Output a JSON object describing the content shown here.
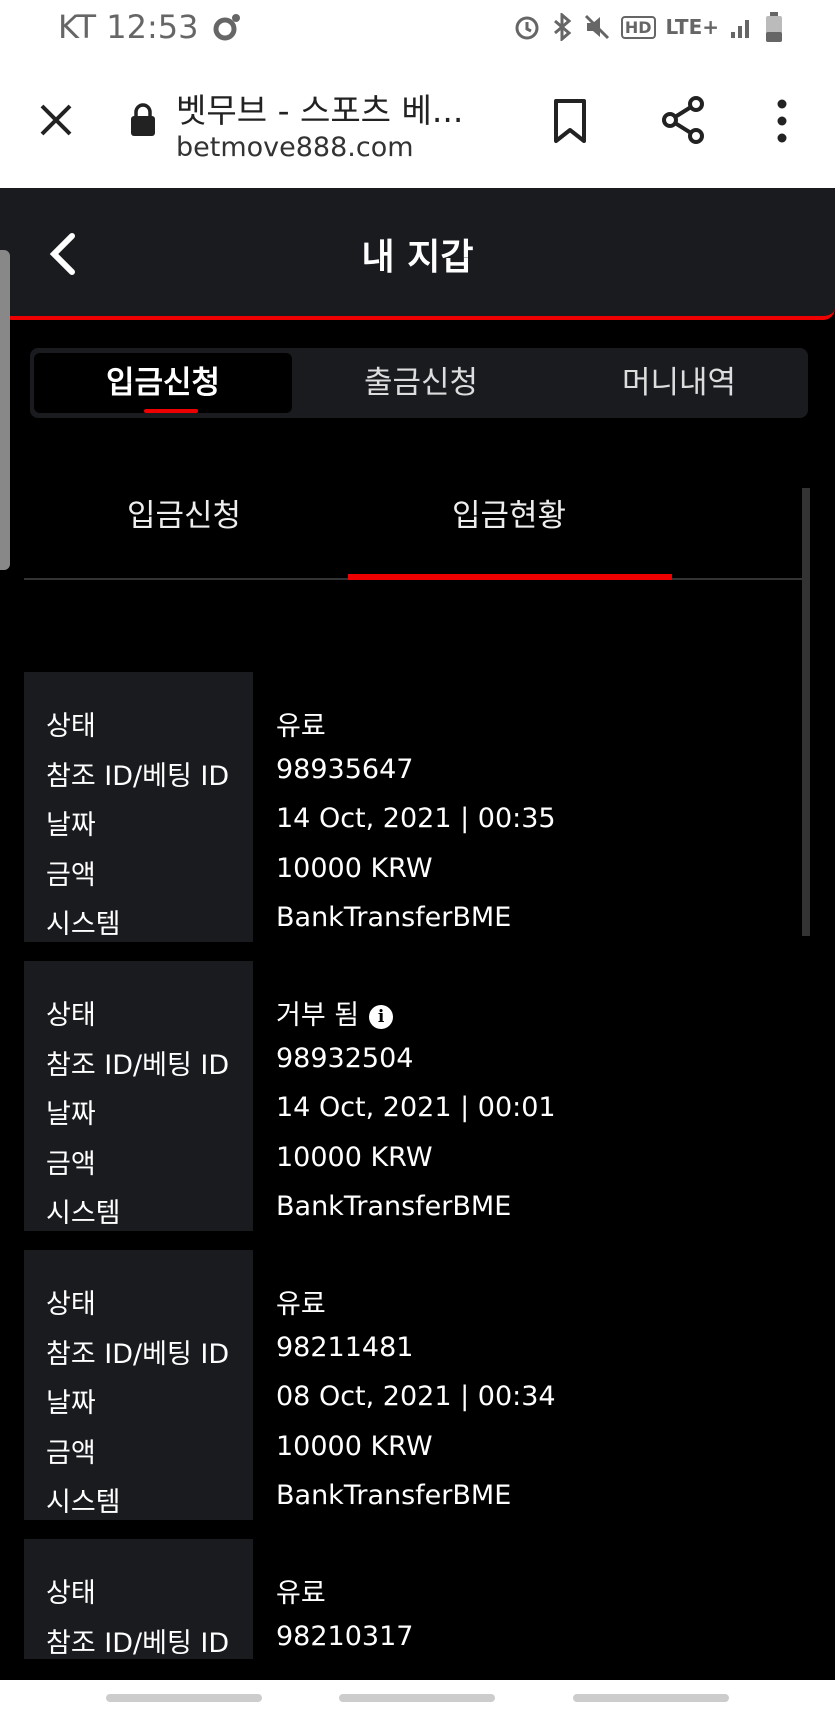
{
  "status_bar": {
    "carrier_time": "KT 12:53",
    "hd": "HD",
    "network": "LTE+"
  },
  "browser": {
    "title": "벳무브 - 스포츠 베...",
    "url": "betmove888.com"
  },
  "header": {
    "title": "내 지갑"
  },
  "main_tabs": [
    {
      "label": "입금신청",
      "active": true
    },
    {
      "label": "출금신청",
      "active": false
    },
    {
      "label": "머니내역",
      "active": false
    }
  ],
  "sub_tabs": [
    {
      "label": "입금신청",
      "active": false
    },
    {
      "label": "입금현황",
      "active": true
    }
  ],
  "labels": {
    "status": "상태",
    "ref_id": "참조 ID/베팅 ID",
    "date": "날짜",
    "amount": "금액",
    "system": "시스템"
  },
  "records": [
    {
      "status": "유료",
      "ref_id": "98935647",
      "date": "14 Oct, 2021 | 00:35",
      "amount": "10000 KRW",
      "system": "BankTransferBME",
      "info": false
    },
    {
      "status": "거부 됨",
      "ref_id": "98932504",
      "date": "14 Oct, 2021 | 00:01",
      "amount": "10000 KRW",
      "system": "BankTransferBME",
      "info": true
    },
    {
      "status": "유료",
      "ref_id": "98211481",
      "date": "08 Oct, 2021 | 00:34",
      "amount": "10000 KRW",
      "system": "BankTransferBME",
      "info": false
    },
    {
      "status": "유료",
      "ref_id": "98210317",
      "date": "",
      "amount": "",
      "system": "",
      "info": false
    }
  ],
  "colors": {
    "accent": "#e00000",
    "panel": "#1a1b1f",
    "background": "#000000"
  }
}
